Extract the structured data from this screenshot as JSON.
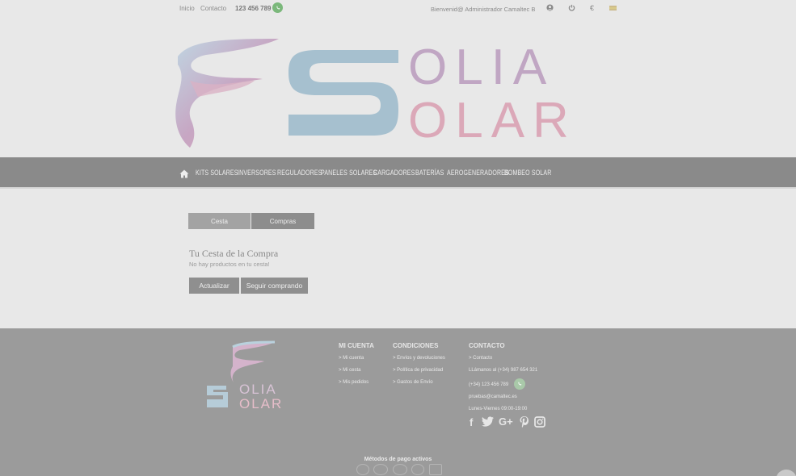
{
  "topbar": {
    "link_inicio": "Inicio",
    "link_contacto": "Contacto",
    "phone": "123 456 789",
    "welcome": "Bienvenid@ Administrador Camaltec B",
    "currency": "€"
  },
  "logo": {
    "line1": "OLIA",
    "line2": "OLAR",
    "big_letter": "S"
  },
  "nav": {
    "items": [
      "KITS SOLARES",
      "INVERSORES",
      "REGULADORES",
      "PANELES SOLARES",
      "CARGADORES",
      "BATERÍAS",
      "AEROGENERADORES",
      "BOMBEO SOLAR"
    ]
  },
  "tabs": {
    "cesta": "Cesta",
    "compras": "Compras"
  },
  "cart": {
    "title": "Tu Cesta de la Compra",
    "empty": "No hay productos en tu cesta!",
    "update_btn": "Actualizar",
    "continue_btn": "Seguir comprando"
  },
  "footer": {
    "logo_line1": "OLIA",
    "logo_line2": "OLAR",
    "mi_cuenta": {
      "title": "MI CUENTA",
      "links": [
        "> Mi cuenta",
        "> Mi cesta",
        "> Mis pedidos"
      ]
    },
    "condiciones": {
      "title": "CONDICIONES",
      "links": [
        "> Envíos y devoluciones",
        "> Política de privacidad",
        "> Gastos de Envío"
      ]
    },
    "contacto": {
      "title": "CONTACTO",
      "link": "> Contacto",
      "call": "LLámanos al (+34) 987 654 321",
      "whatsapp": "(+34) 123 456 789",
      "email": "pruebas@camaltec.es",
      "hours": "Lunes-Viernes 09:00-19:00"
    },
    "social_icons": [
      "facebook-icon",
      "twitter-icon",
      "google-plus-icon",
      "pinterest-icon",
      "instagram-icon"
    ],
    "payments_title": "Métodos de pago activos"
  }
}
